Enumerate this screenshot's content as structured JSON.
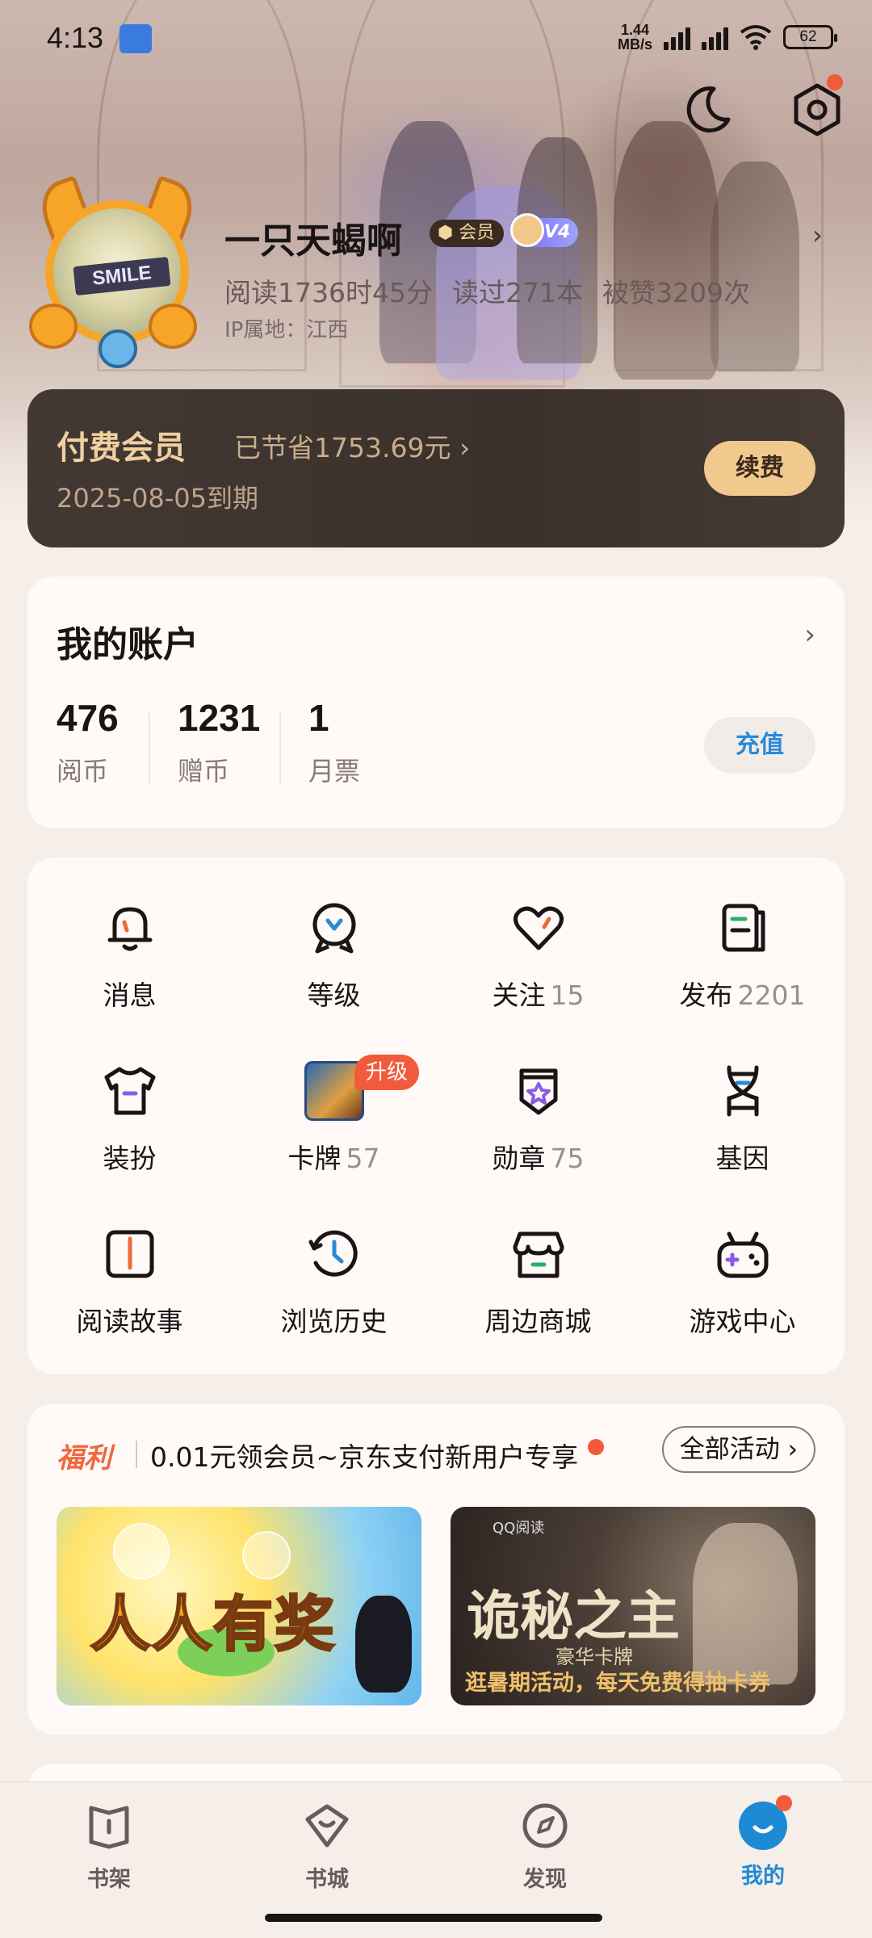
{
  "status_bar": {
    "time": "4:13",
    "net_speed_value": "1.44",
    "net_speed_unit": "MB/s",
    "battery": "62"
  },
  "profile": {
    "avatar_text": "SMILE",
    "username": "一只天蝎啊",
    "vip_badge": "会员",
    "level_badge": "V4",
    "stats": [
      "阅读1736时45分",
      "读过271本",
      "被赞3209次"
    ],
    "ip_location": "IP属地：江西"
  },
  "vip": {
    "title": "付费会员",
    "saved": "已节省1753.69元 ›",
    "expire": "2025-08-05到期",
    "renew_label": "续费"
  },
  "account": {
    "title": "我的账户",
    "items": [
      {
        "value": "476",
        "label": "阅币"
      },
      {
        "value": "1231",
        "label": "赠币"
      },
      {
        "value": "1",
        "label": "月票"
      }
    ],
    "recharge_label": "充值"
  },
  "menu": {
    "items": [
      {
        "label": "消息",
        "count": "",
        "icon": "bell-icon"
      },
      {
        "label": "等级",
        "count": "",
        "icon": "level-icon"
      },
      {
        "label": "关注",
        "count": "15",
        "icon": "heart-icon"
      },
      {
        "label": "发布",
        "count": "2201",
        "icon": "publish-icon"
      },
      {
        "label": "装扮",
        "count": "",
        "icon": "tshirt-icon"
      },
      {
        "label": "卡牌",
        "count": "57",
        "icon": "card-icon",
        "badge": "升级"
      },
      {
        "label": "勋章",
        "count": "75",
        "icon": "medal-icon"
      },
      {
        "label": "基因",
        "count": "",
        "icon": "dna-icon"
      },
      {
        "label": "阅读故事",
        "count": "",
        "icon": "book-icon"
      },
      {
        "label": "浏览历史",
        "count": "",
        "icon": "clock-icon"
      },
      {
        "label": "周边商城",
        "count": "",
        "icon": "shop-icon"
      },
      {
        "label": "游戏中心",
        "count": "",
        "icon": "gamepad-icon"
      }
    ]
  },
  "welfare": {
    "tag": "福利",
    "text": "0.01元领会员~京东支付新用户专享",
    "all_label": "全部活动 ›",
    "banner1_text": "人人有奖",
    "banner2_logo": "QQ阅读",
    "banner2_title": "诡秘之主",
    "banner2_sub": "豪华卡牌",
    "banner2_cta": "逛暑期活动，每天免费得抽卡券"
  },
  "bottom_nav": {
    "items": [
      {
        "label": "书架",
        "icon": "bookshelf-icon"
      },
      {
        "label": "书城",
        "icon": "bookstore-icon"
      },
      {
        "label": "发现",
        "icon": "compass-icon"
      },
      {
        "label": "我的",
        "icon": "profile-icon",
        "active": true
      }
    ]
  },
  "colors": {
    "accent_blue": "#1e8ad6",
    "alert_red": "#f25a3c",
    "vip_gold": "#f0c98f",
    "welfare_orange": "#f0683c"
  }
}
